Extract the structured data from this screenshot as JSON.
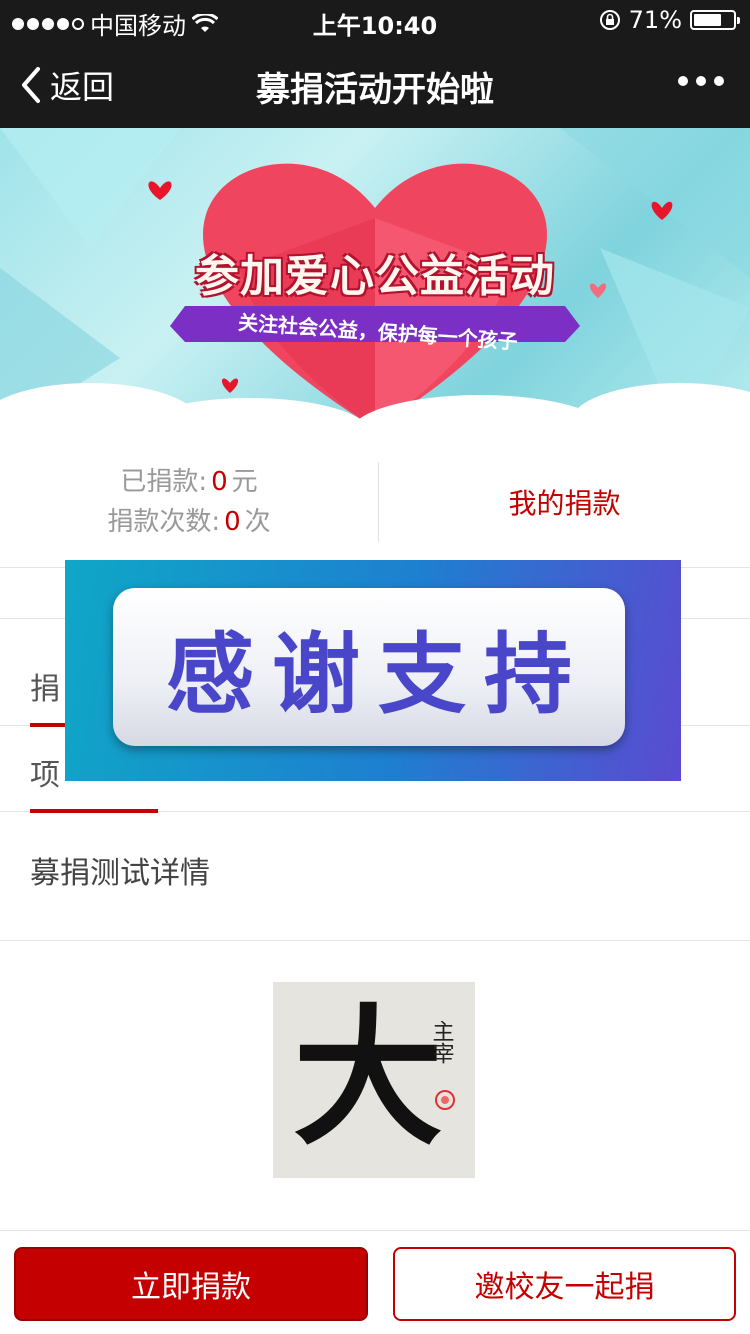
{
  "status_bar": {
    "carrier": "中国移动",
    "time": "上午10:40",
    "battery": "71%",
    "battery_level": 0.71
  },
  "nav": {
    "back_label": "返回",
    "title": "募捐活动开始啦"
  },
  "banner": {
    "title": "参加爱心公益活动",
    "subtitle": "关注社会公益，保护每一个孩子"
  },
  "stats": {
    "donated_label": "已捐款:",
    "donated_value": "0",
    "donated_unit": "元",
    "count_label": "捐款次数:",
    "count_value": "0",
    "count_unit": "次",
    "my_donation": "我的捐款"
  },
  "tabs": {
    "donation_tab": "捐",
    "project_tab": "项"
  },
  "detail": {
    "text": "募捐测试详情",
    "image_chars": "大",
    "image_seal": "主宰"
  },
  "overlay": {
    "text": "感谢支持"
  },
  "bottom": {
    "donate_now": "立即捐款",
    "invite": "邀校友一起捐"
  }
}
